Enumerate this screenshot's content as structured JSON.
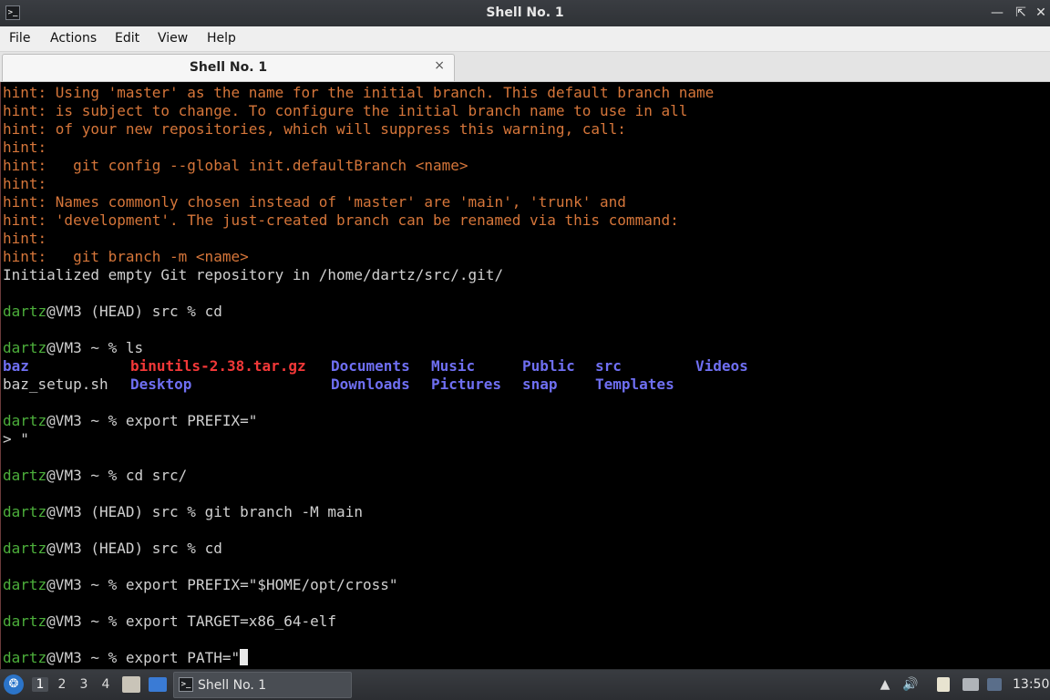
{
  "window": {
    "title": "Shell No. 1",
    "app_icon": "terminal-icon",
    "app_icon_glyph": ">_",
    "minimize_glyph": "—",
    "maximize_glyph": "⇱",
    "close_glyph": "✕"
  },
  "menu": [
    "File",
    "Actions",
    "Edit",
    "View",
    "Help"
  ],
  "tab": {
    "label": "Shell No. 1",
    "close_glyph": "×"
  },
  "terminal": {
    "hints": [
      "hint: Using 'master' as the name for the initial branch. This default branch name",
      "hint: is subject to change. To configure the initial branch name to use in all",
      "hint: of your new repositories, which will suppress this warning, call:",
      "hint:",
      "hint:   git config --global init.defaultBranch <name>",
      "hint:",
      "hint: Names commonly chosen instead of 'master' are 'main', 'trunk' and",
      "hint: 'development'. The just-created branch can be renamed via this command:",
      "hint:",
      "hint:   git branch -m <name>"
    ],
    "init_message": "Initialized empty Git repository in /home/dartz/src/.git/",
    "user": "dartz",
    "prompt_head_src": "@VM3 (HEAD) src % ",
    "prompt_home": "@VM3 ~ % ",
    "cmd_cd": "cd",
    "cmd_ls": "ls",
    "ls_row1": [
      "baz",
      "binutils-2.38.tar.gz",
      "Documents",
      "Music",
      "Public",
      "src",
      "Videos"
    ],
    "ls_row2": [
      "baz_setup.sh",
      "Desktop",
      "Downloads",
      "Pictures",
      "snap",
      "Templates"
    ],
    "cmd_export_prefix_open": "export PREFIX=\"",
    "continuation": "> \"",
    "cmd_cd_src": "cd src/",
    "cmd_git_branch": "git branch -M main",
    "cmd_cd2": "cd",
    "cmd_export_prefix": "export PREFIX=\"$HOME/opt/cross\"",
    "cmd_export_target": "export TARGET=x86_64-elf",
    "cmd_export_path": "export PATH=\""
  },
  "taskbar": {
    "start_icon": "start-menu-icon",
    "start_glyph": "❂",
    "desktops": [
      "1",
      "2",
      "3",
      "4"
    ],
    "active_desktop": "1",
    "window_label": "Shell No. 1",
    "tray_up_glyph": "▲",
    "volume_glyph": "🔊",
    "clock": "13:50"
  },
  "colors": {
    "hint": "#d6763a",
    "user": "#4caf3b",
    "directory": "#6f6ff2",
    "archive": "#f23838"
  }
}
